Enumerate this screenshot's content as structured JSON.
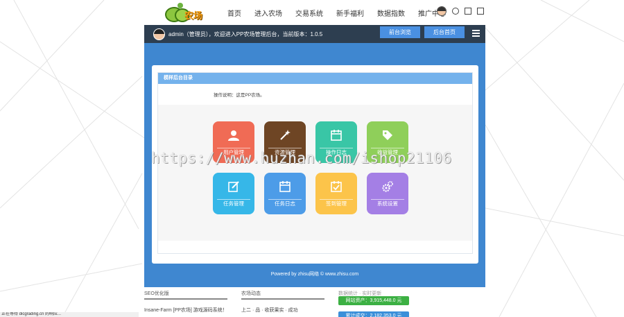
{
  "logo": {
    "text": "农场"
  },
  "nav": {
    "links": [
      "首页",
      "进入农场",
      "交易系统",
      "新手福利",
      "数据指数",
      "推广中心"
    ]
  },
  "admin": {
    "welcome": "admin（管理员），欢迎进入PP农场管理后台，当前版本：1.0.5",
    "home_btn": "前台浏览",
    "back_btn": "后台首页"
  },
  "card": {
    "title": "模样后台目录",
    "desc": "操作说明：这是PP农场。"
  },
  "tiles": [
    {
      "label": "用户管理",
      "color": "#f06b55",
      "icon": "user-icon"
    },
    {
      "label": "资源管理",
      "color": "#6e4524",
      "icon": "magic-wand-icon"
    },
    {
      "label": "操作日志",
      "color": "#39c6a6",
      "icon": "calendar-icon"
    },
    {
      "label": "收益管理",
      "color": "#8fcf5a",
      "icon": "tag-icon"
    },
    {
      "label": "任务管理",
      "color": "#36b7e8",
      "icon": "edit-icon"
    },
    {
      "label": "任务日志",
      "color": "#4d9ce8",
      "icon": "calendar-icon"
    },
    {
      "label": "签到管理",
      "color": "#fcc44a",
      "icon": "calendar-check-icon"
    },
    {
      "label": "系统设置",
      "color": "#a47fe5",
      "icon": "gears-icon"
    }
  ],
  "footer": "Powered by zhisu网络 © www.zhisu.com",
  "watermark": "https://www.huzhan.com/ishop21106",
  "lower": {
    "col1_title": "SEO优化版",
    "col1_text": "Insane-Farm [PP农场] 游戏源码系统！",
    "col2_title": "农场动态",
    "col2_text": "上二 · 品 · 收获果实 · 成功",
    "col3_title": "数据统计 · 实时更新",
    "stat1": "网站资产：3,915,448.0 元",
    "stat2": "累计成交：2,182,353.0 元"
  },
  "statusbar": "正在等待 dicgrading.cn 的响应..."
}
